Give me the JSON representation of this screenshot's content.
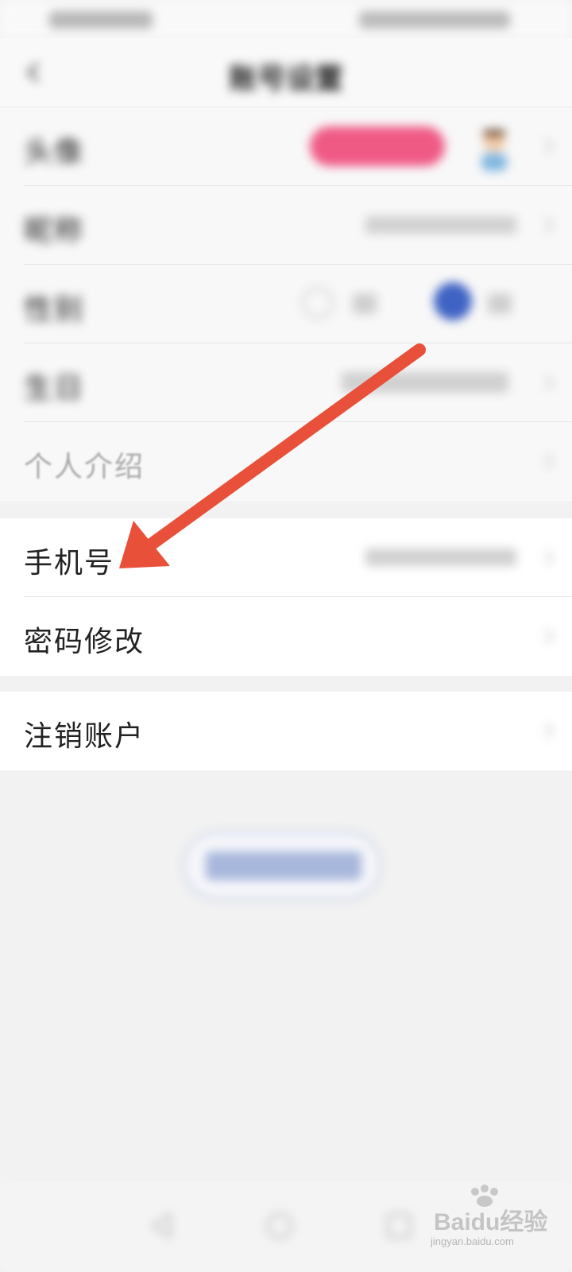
{
  "nav": {
    "title": "账号设置"
  },
  "profile_group": {
    "rows": [
      {
        "label": "头像"
      },
      {
        "label": "昵称"
      },
      {
        "label": "性别"
      },
      {
        "label": "生日"
      },
      {
        "label": "个人介绍"
      }
    ]
  },
  "security_group": {
    "rows": [
      {
        "label": "手机号"
      },
      {
        "label": "密码修改"
      }
    ]
  },
  "account_group": {
    "rows": [
      {
        "label": "注销账户"
      }
    ]
  },
  "logout_button": {
    "label": "退出当前账号"
  },
  "annotation": {
    "color": "#e8503a",
    "points_to": "手机号"
  },
  "watermark": {
    "brand": "Baidu经验",
    "sub": "jingyan.baidu.com"
  },
  "colors": {
    "accent_blue": "#3f63c4",
    "badge_pink": "#ef5a85",
    "arrow_red": "#e8503a"
  }
}
